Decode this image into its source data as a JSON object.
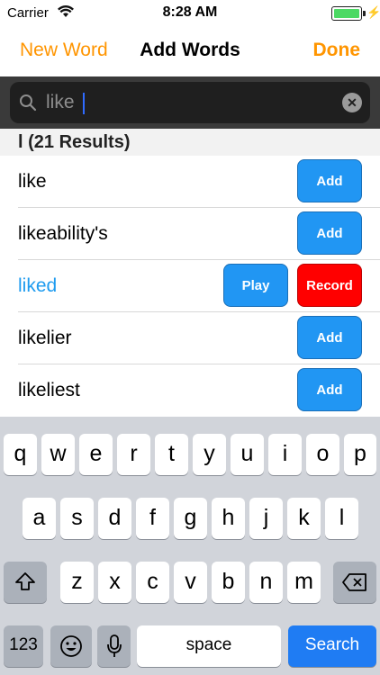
{
  "status": {
    "carrier": "Carrier",
    "time": "8:28 AM"
  },
  "nav": {
    "left": "New Word",
    "title": "Add Words",
    "right": "Done"
  },
  "search": {
    "value": "like"
  },
  "section": {
    "header": "l (21 Results)"
  },
  "rows": [
    {
      "word": "like",
      "button": "Add"
    },
    {
      "word": "likeability's",
      "button": "Add"
    },
    {
      "word": "liked",
      "play": "Play",
      "record": "Record"
    },
    {
      "word": "likelier",
      "button": "Add"
    },
    {
      "word": "likeliest",
      "button": "Add"
    }
  ],
  "keyboard": {
    "row1": [
      "q",
      "w",
      "e",
      "r",
      "t",
      "y",
      "u",
      "i",
      "o",
      "p"
    ],
    "row2": [
      "a",
      "s",
      "d",
      "f",
      "g",
      "h",
      "j",
      "k",
      "l"
    ],
    "row3": [
      "z",
      "x",
      "c",
      "v",
      "b",
      "n",
      "m"
    ],
    "numbers": "123",
    "space": "space",
    "search": "Search"
  },
  "colors": {
    "accent": "#ff9500",
    "add": "#2196f3",
    "record": "#ff0000",
    "battery": "#4cd964"
  }
}
